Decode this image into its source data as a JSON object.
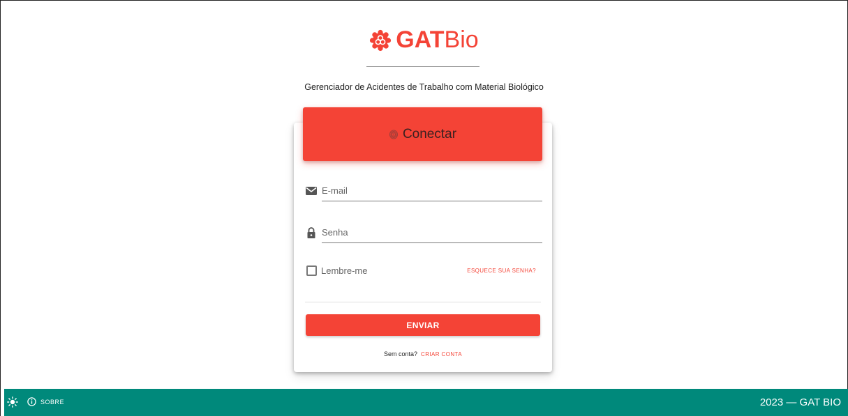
{
  "brand": {
    "name_bold": "GAT",
    "name_light": "Bio",
    "subtitle": "Gerenciador de Acidentes de Trabalho com Material Biológico",
    "color": "#f44336"
  },
  "login_card": {
    "header_icon": "fingerprint-icon",
    "header_title": "Conectar",
    "email": {
      "icon": "envelope-icon",
      "placeholder": "E-mail",
      "value": ""
    },
    "password": {
      "icon": "lock-icon",
      "placeholder": "Senha",
      "value": ""
    },
    "remember_label": "Lembre-me",
    "remember_checked": false,
    "forgot_link": "ESQUECE SUA SENHA?",
    "submit_label": "ENVIAR",
    "signup_prompt": "Sem conta?",
    "signup_link": "CRIAR CONTA"
  },
  "footer": {
    "theme_icon": "sun-icon",
    "about_icon": "info-icon",
    "about_label": "SOBRE",
    "copyright": "2023 — GAT BIO",
    "color": "#00897b"
  }
}
